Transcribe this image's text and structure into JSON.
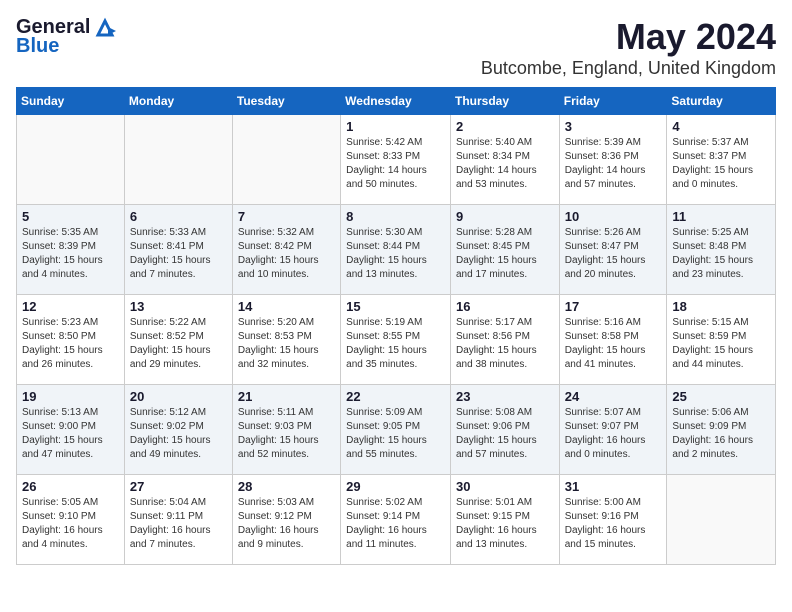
{
  "header": {
    "logo_general": "General",
    "logo_blue": "Blue",
    "main_title": "May 2024",
    "subtitle": "Butcombe, England, United Kingdom"
  },
  "weekdays": [
    "Sunday",
    "Monday",
    "Tuesday",
    "Wednesday",
    "Thursday",
    "Friday",
    "Saturday"
  ],
  "weeks": [
    [
      {
        "day": "",
        "info": ""
      },
      {
        "day": "",
        "info": ""
      },
      {
        "day": "",
        "info": ""
      },
      {
        "day": "1",
        "info": "Sunrise: 5:42 AM\nSunset: 8:33 PM\nDaylight: 14 hours\nand 50 minutes."
      },
      {
        "day": "2",
        "info": "Sunrise: 5:40 AM\nSunset: 8:34 PM\nDaylight: 14 hours\nand 53 minutes."
      },
      {
        "day": "3",
        "info": "Sunrise: 5:39 AM\nSunset: 8:36 PM\nDaylight: 14 hours\nand 57 minutes."
      },
      {
        "day": "4",
        "info": "Sunrise: 5:37 AM\nSunset: 8:37 PM\nDaylight: 15 hours\nand 0 minutes."
      }
    ],
    [
      {
        "day": "5",
        "info": "Sunrise: 5:35 AM\nSunset: 8:39 PM\nDaylight: 15 hours\nand 4 minutes."
      },
      {
        "day": "6",
        "info": "Sunrise: 5:33 AM\nSunset: 8:41 PM\nDaylight: 15 hours\nand 7 minutes."
      },
      {
        "day": "7",
        "info": "Sunrise: 5:32 AM\nSunset: 8:42 PM\nDaylight: 15 hours\nand 10 minutes."
      },
      {
        "day": "8",
        "info": "Sunrise: 5:30 AM\nSunset: 8:44 PM\nDaylight: 15 hours\nand 13 minutes."
      },
      {
        "day": "9",
        "info": "Sunrise: 5:28 AM\nSunset: 8:45 PM\nDaylight: 15 hours\nand 17 minutes."
      },
      {
        "day": "10",
        "info": "Sunrise: 5:26 AM\nSunset: 8:47 PM\nDaylight: 15 hours\nand 20 minutes."
      },
      {
        "day": "11",
        "info": "Sunrise: 5:25 AM\nSunset: 8:48 PM\nDaylight: 15 hours\nand 23 minutes."
      }
    ],
    [
      {
        "day": "12",
        "info": "Sunrise: 5:23 AM\nSunset: 8:50 PM\nDaylight: 15 hours\nand 26 minutes."
      },
      {
        "day": "13",
        "info": "Sunrise: 5:22 AM\nSunset: 8:52 PM\nDaylight: 15 hours\nand 29 minutes."
      },
      {
        "day": "14",
        "info": "Sunrise: 5:20 AM\nSunset: 8:53 PM\nDaylight: 15 hours\nand 32 minutes."
      },
      {
        "day": "15",
        "info": "Sunrise: 5:19 AM\nSunset: 8:55 PM\nDaylight: 15 hours\nand 35 minutes."
      },
      {
        "day": "16",
        "info": "Sunrise: 5:17 AM\nSunset: 8:56 PM\nDaylight: 15 hours\nand 38 minutes."
      },
      {
        "day": "17",
        "info": "Sunrise: 5:16 AM\nSunset: 8:58 PM\nDaylight: 15 hours\nand 41 minutes."
      },
      {
        "day": "18",
        "info": "Sunrise: 5:15 AM\nSunset: 8:59 PM\nDaylight: 15 hours\nand 44 minutes."
      }
    ],
    [
      {
        "day": "19",
        "info": "Sunrise: 5:13 AM\nSunset: 9:00 PM\nDaylight: 15 hours\nand 47 minutes."
      },
      {
        "day": "20",
        "info": "Sunrise: 5:12 AM\nSunset: 9:02 PM\nDaylight: 15 hours\nand 49 minutes."
      },
      {
        "day": "21",
        "info": "Sunrise: 5:11 AM\nSunset: 9:03 PM\nDaylight: 15 hours\nand 52 minutes."
      },
      {
        "day": "22",
        "info": "Sunrise: 5:09 AM\nSunset: 9:05 PM\nDaylight: 15 hours\nand 55 minutes."
      },
      {
        "day": "23",
        "info": "Sunrise: 5:08 AM\nSunset: 9:06 PM\nDaylight: 15 hours\nand 57 minutes."
      },
      {
        "day": "24",
        "info": "Sunrise: 5:07 AM\nSunset: 9:07 PM\nDaylight: 16 hours\nand 0 minutes."
      },
      {
        "day": "25",
        "info": "Sunrise: 5:06 AM\nSunset: 9:09 PM\nDaylight: 16 hours\nand 2 minutes."
      }
    ],
    [
      {
        "day": "26",
        "info": "Sunrise: 5:05 AM\nSunset: 9:10 PM\nDaylight: 16 hours\nand 4 minutes."
      },
      {
        "day": "27",
        "info": "Sunrise: 5:04 AM\nSunset: 9:11 PM\nDaylight: 16 hours\nand 7 minutes."
      },
      {
        "day": "28",
        "info": "Sunrise: 5:03 AM\nSunset: 9:12 PM\nDaylight: 16 hours\nand 9 minutes."
      },
      {
        "day": "29",
        "info": "Sunrise: 5:02 AM\nSunset: 9:14 PM\nDaylight: 16 hours\nand 11 minutes."
      },
      {
        "day": "30",
        "info": "Sunrise: 5:01 AM\nSunset: 9:15 PM\nDaylight: 16 hours\nand 13 minutes."
      },
      {
        "day": "31",
        "info": "Sunrise: 5:00 AM\nSunset: 9:16 PM\nDaylight: 16 hours\nand 15 minutes."
      },
      {
        "day": "",
        "info": ""
      }
    ]
  ]
}
